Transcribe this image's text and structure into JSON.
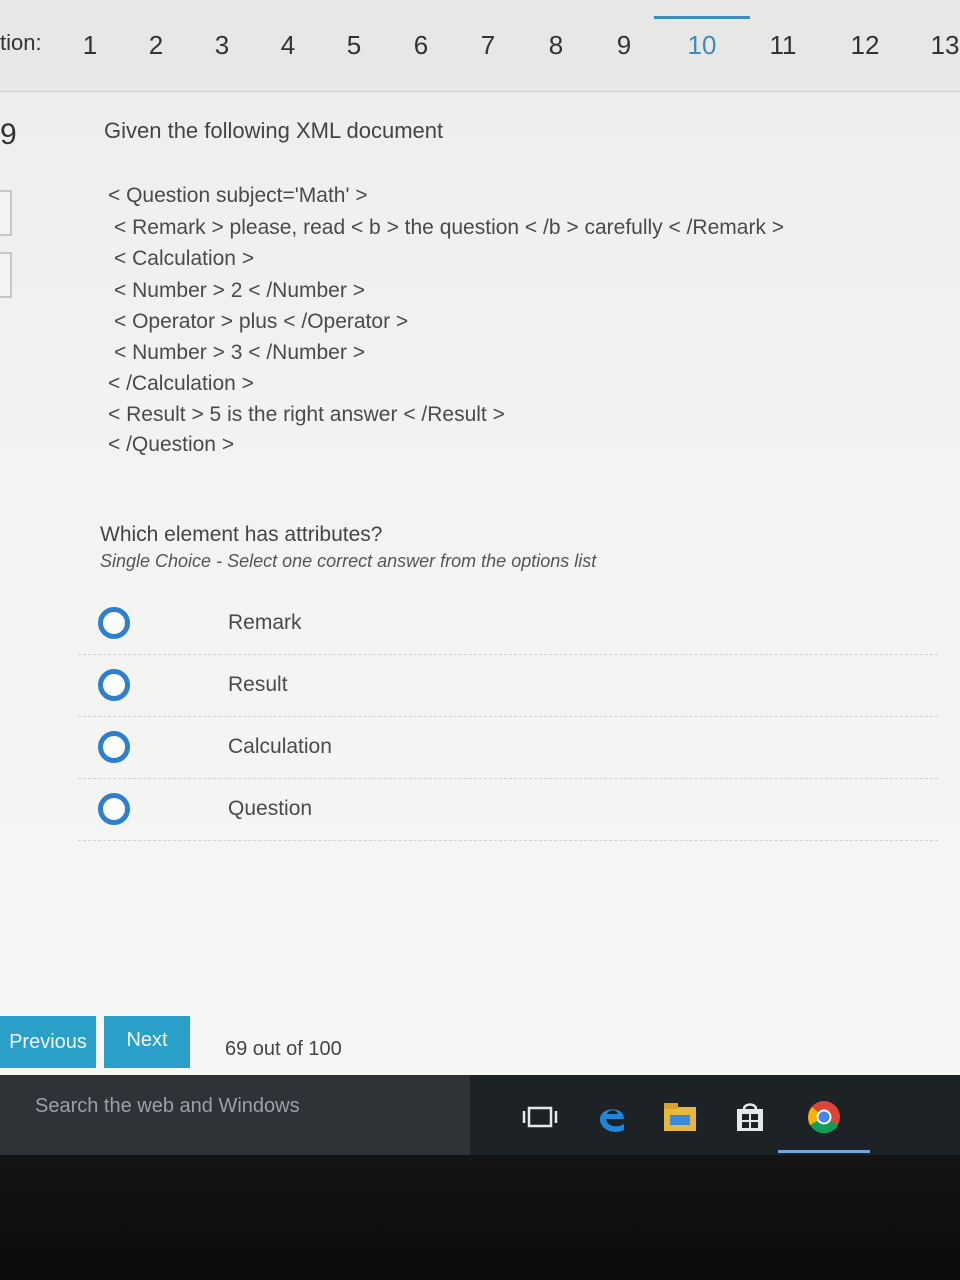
{
  "nav": {
    "label": "tion:",
    "numbers": [
      "1",
      "2",
      "3",
      "4",
      "5",
      "6",
      "7",
      "8",
      "9",
      "10",
      "11",
      "12",
      "13"
    ],
    "active": "10"
  },
  "question": {
    "number": "9",
    "stem": "Given the following XML document",
    "xml_lines": [
      "< Question subject='Math' >",
      "< Remark > please, read  < b >  the question  < /b >  carefully  < /Remark >",
      "< Calculation >",
      "< Number > 2 < /Number >",
      "< Operator > plus < /Operator >",
      "< Number > 3 < /Number >",
      "< /Calculation >",
      "< Result > 5 is the right answer < /Result >",
      "< /Question >"
    ],
    "prompt": "Which element has attributes?",
    "instruction": "Single Choice - Select one correct answer from the options list",
    "options": [
      "Remark",
      "Result",
      "Calculation",
      "Question"
    ]
  },
  "footer": {
    "previous_label": "Previous",
    "next_label": "Next >",
    "progress_text": "69 out of 100"
  },
  "taskbar": {
    "search_placeholder": "Search the web and Windows",
    "icons": [
      "task-view-icon",
      "edge-icon",
      "file-explorer-icon",
      "store-icon",
      "chrome-icon"
    ]
  },
  "colors": {
    "accent": "#2f7fcf",
    "button": "#2aa0c8",
    "taskbar": "#1d2227"
  }
}
